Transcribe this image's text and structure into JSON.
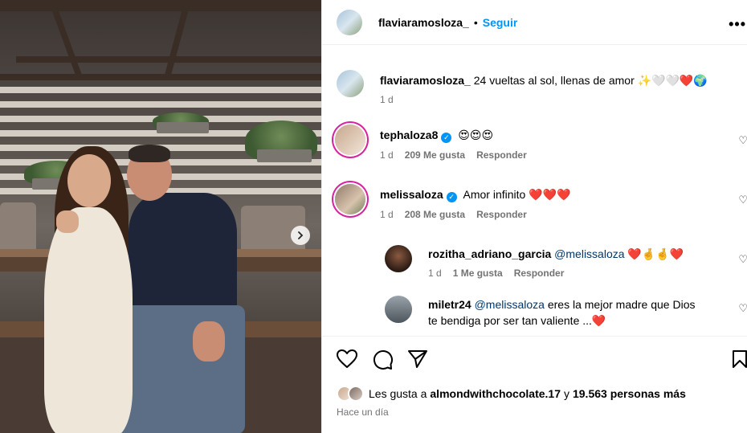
{
  "post": {
    "username": "flaviaramosloza_",
    "dot": "•",
    "follow_label": "Seguir",
    "more_label": "•••",
    "caption": {
      "username": "flaviaramosloza_",
      "text": "24 vueltas al sol, llenas de amor ✨🤍🤍❤️🌍",
      "time": "1 d"
    }
  },
  "comments": [
    {
      "username": "tephaloza8",
      "verified": true,
      "text": "😍😍😍",
      "time": "1 d",
      "likes": "209 Me gusta",
      "reply_label": "Responder"
    },
    {
      "username": "melissaloza",
      "verified": true,
      "text": "Amor infinito ❤️❤️❤️",
      "time": "1 d",
      "likes": "208 Me gusta",
      "reply_label": "Responder"
    }
  ],
  "replies": [
    {
      "username": "rozitha_adriano_garcia",
      "mention": "@melissaloza",
      "text": "❤️🤞🤞❤️",
      "time": "1 d",
      "likes": "1 Me gusta",
      "reply_label": "Responder"
    },
    {
      "username": "miletr24",
      "mention": "@melissaloza",
      "text": "eres la mejor madre que Dios",
      "text2": "te bendiga por ser tan valiente ...❤️"
    }
  ],
  "likes_summary": {
    "prefix": "Les gusta a",
    "user": "almondwithchocolate.17",
    "middle": "y",
    "others": "19.563 personas más"
  },
  "posted_ago": "Hace un día",
  "icons": {
    "like": "heart-icon",
    "comment": "comment-icon",
    "share": "send-icon",
    "save": "bookmark-icon",
    "next": "chevron-right-icon",
    "more": "more-options-icon",
    "verified": "verified-badge-icon"
  },
  "colors": {
    "follow": "#0095f6",
    "verified": "#0095f6",
    "meta": "#737373",
    "mention": "#00376b"
  }
}
